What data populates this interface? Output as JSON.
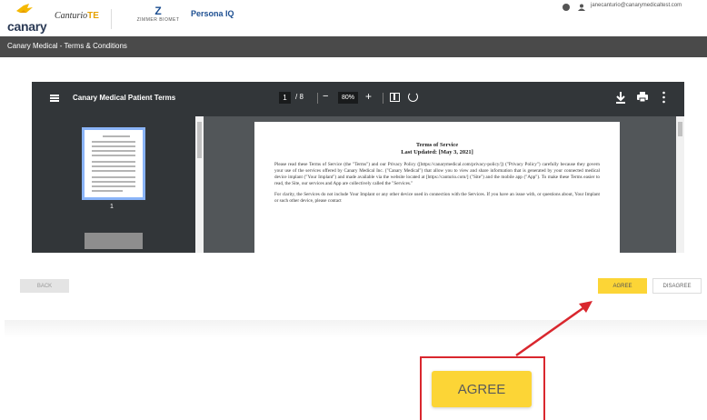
{
  "header": {
    "logo_text": "canary",
    "canturio_text": "Canturio",
    "canturio_suffix": "TE",
    "zimmer_mark": "Z",
    "zimmer_text": "ZIMMER BIOMET",
    "persona_text": "Persona IQ",
    "user_email": "janecanturio@canarymedicaltest.com"
  },
  "titlebar": {
    "title": "Canary Medical - Terms & Conditions"
  },
  "viewer": {
    "doc_title": "Canary Medical Patient Terms",
    "page_current": "1",
    "page_total": "/ 8",
    "zoom": "80%",
    "thumb_page_number": "1",
    "document": {
      "heading": "Terms of Service",
      "updated": "Last Updated: [May 3, 2021]",
      "paragraph1": "Please read these Terms of Service (the \"Terms\") and our Privacy Policy ([https://canarymedical.com/privacy-policy/]) (\"Privacy Policy\") carefully because they govern your use of the services offered by Canary Medical Inc. (\"Canary Medical\") that allow you to view and share information that is generated by your connected medical device implant (\"Your Implant\") and made available via the website located at [https://canturio.com/] (\"Site\") and the mobile app (\"App\"). To make these Terms easier to read, the Site, our services and App are collectively called the \"Services.\"",
      "paragraph2": "For clarity, the Services do not include Your Implant or any other device used in connection with the Services. If you have an issue with, or questions about, Your Implant or such other device, please contact"
    }
  },
  "actions": {
    "back_label": "BACK",
    "agree_label": "AGREE",
    "disagree_label": "DISAGREE"
  },
  "callout": {
    "agree_label": "AGREE"
  },
  "colors": {
    "agree_yellow": "#fcd536",
    "titlebar": "#4a4a4a",
    "annotation_red": "#d9272e"
  },
  "icons": [
    "canary-bird-icon",
    "settings-icon",
    "user-icon",
    "menu-icon",
    "fit-page-icon",
    "rotate-icon",
    "download-icon",
    "print-icon",
    "more-icon"
  ]
}
